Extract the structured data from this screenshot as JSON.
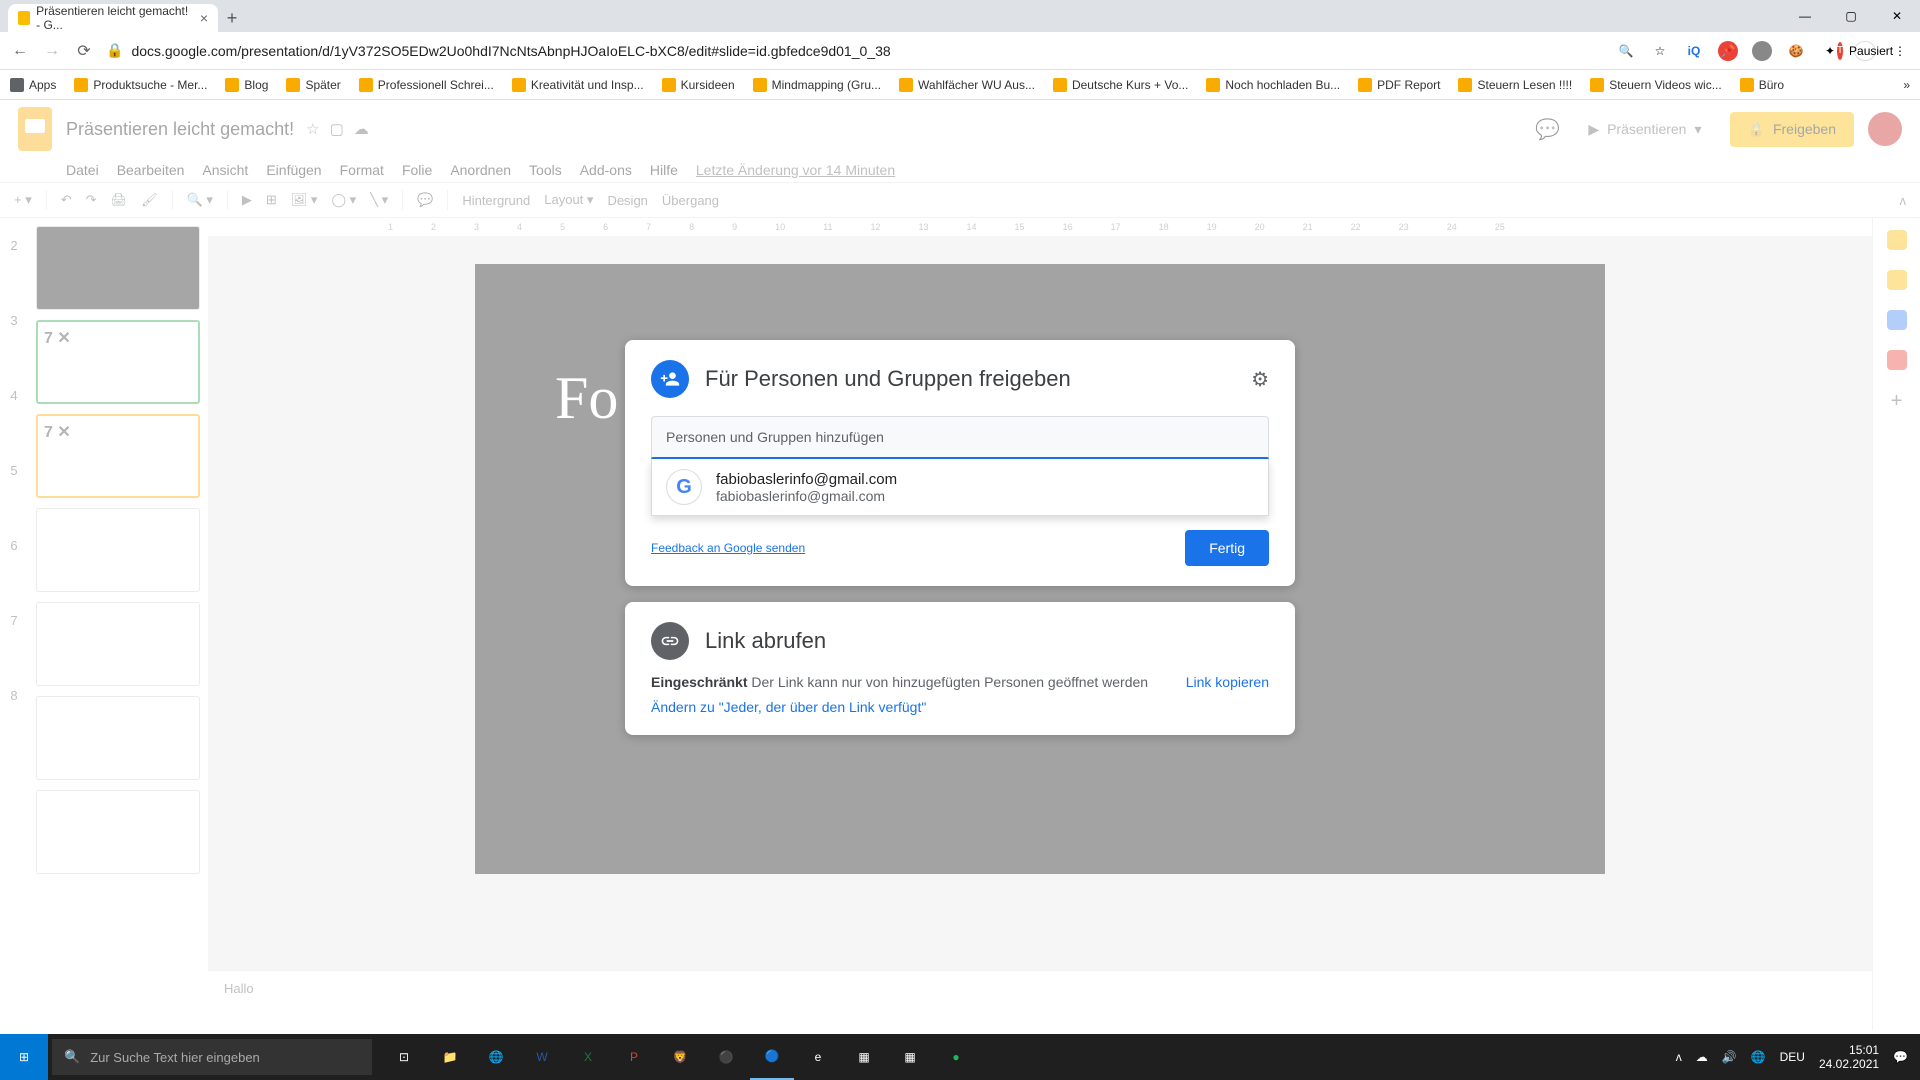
{
  "browser": {
    "tab_title": "Präsentieren leicht gemacht! - G...",
    "url": "docs.google.com/presentation/d/1yV372SO5EDw2Uo0hdI7NcNtsAbnpHJOaIoELC-bXC8/edit#slide=id.gbfedce9d01_0_38",
    "pausiert": "Pausiert",
    "window": {
      "min": "—",
      "max": "▢",
      "close": "✕"
    }
  },
  "bookmarks": [
    "Apps",
    "Produktsuche - Mer...",
    "Blog",
    "Später",
    "Professionell Schrei...",
    "Kreativität und Insp...",
    "Kursideen",
    "Mindmapping (Gru...",
    "Wahlfächer WU Aus...",
    "Deutsche Kurs + Vo...",
    "Noch hochladen Bu...",
    "PDF Report",
    "Steuern Lesen !!!!",
    "Steuern Videos wic...",
    "Büro"
  ],
  "app": {
    "doc_title": "Präsentieren leicht gemacht!",
    "present": "Präsentieren",
    "share": "Freigeben",
    "menus": [
      "Datei",
      "Bearbeiten",
      "Ansicht",
      "Einfügen",
      "Format",
      "Folie",
      "Anordnen",
      "Tools",
      "Add-ons",
      "Hilfe"
    ],
    "last_edit": "Letzte Änderung vor 14 Minuten",
    "toolbar": {
      "bg": "Hintergrund",
      "layout": "Layout",
      "design": "Design",
      "trans": "Übergang"
    },
    "notes": "Hallo"
  },
  "thumbs": {
    "t3": "7 ✕",
    "t4": "7 ✕"
  },
  "dialog": {
    "share_title": "Für Personen und Gruppen freigeben",
    "input_placeholder": "Personen und Gruppen hinzufügen",
    "suggestion_name": "fabiobaslerinfo@gmail.com",
    "suggestion_email": "fabiobaslerinfo@gmail.com",
    "feedback": "Feedback an Google senden",
    "done": "Fertig",
    "link_title": "Link abrufen",
    "restricted_bold": "Eingeschränkt",
    "restricted_text": " Der Link kann nur von hinzugefügten Personen geöffnet werden",
    "copy": "Link kopieren",
    "change": "Ändern zu \"Jeder, der über den Link verfügt\""
  },
  "taskbar": {
    "search_placeholder": "Zur Suche Text hier eingeben",
    "lang": "DEU",
    "time": "15:01",
    "date": "24.02.2021"
  },
  "ruler": [
    "1",
    "2",
    "3",
    "4",
    "5",
    "6",
    "7",
    "8",
    "9",
    "10",
    "11",
    "12",
    "13",
    "14",
    "15",
    "16",
    "17",
    "18",
    "19",
    "20",
    "21",
    "22",
    "23",
    "24",
    "25"
  ]
}
